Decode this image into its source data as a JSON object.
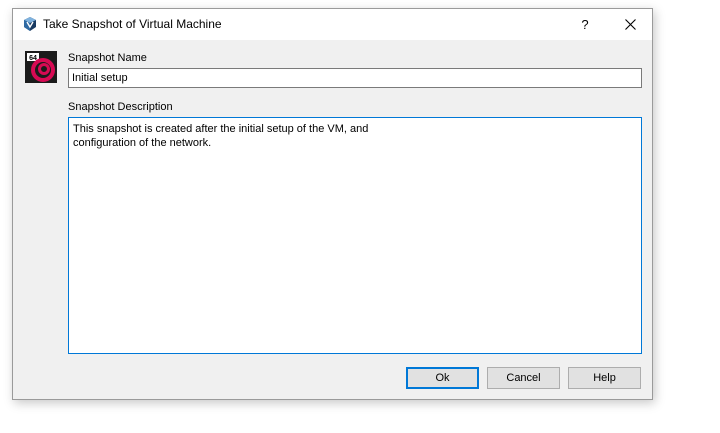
{
  "window": {
    "title": "Take Snapshot of Virtual Machine",
    "help_glyph": "?",
    "app_icon": "virtualbox-icon",
    "vm_icon": "debian-64bit-icon",
    "vm_badge": "64"
  },
  "form": {
    "name_label": "Snapshot Name",
    "name_value": "Initial setup",
    "description_label": "Snapshot Description",
    "description_value": "This snapshot is created after the initial setup of the VM, and\nconfiguration of the network."
  },
  "buttons": {
    "ok": "Ok",
    "cancel": "Cancel",
    "help": "Help"
  },
  "colors": {
    "accent": "#0078d7",
    "vm_icon_red": "#d70a53"
  }
}
